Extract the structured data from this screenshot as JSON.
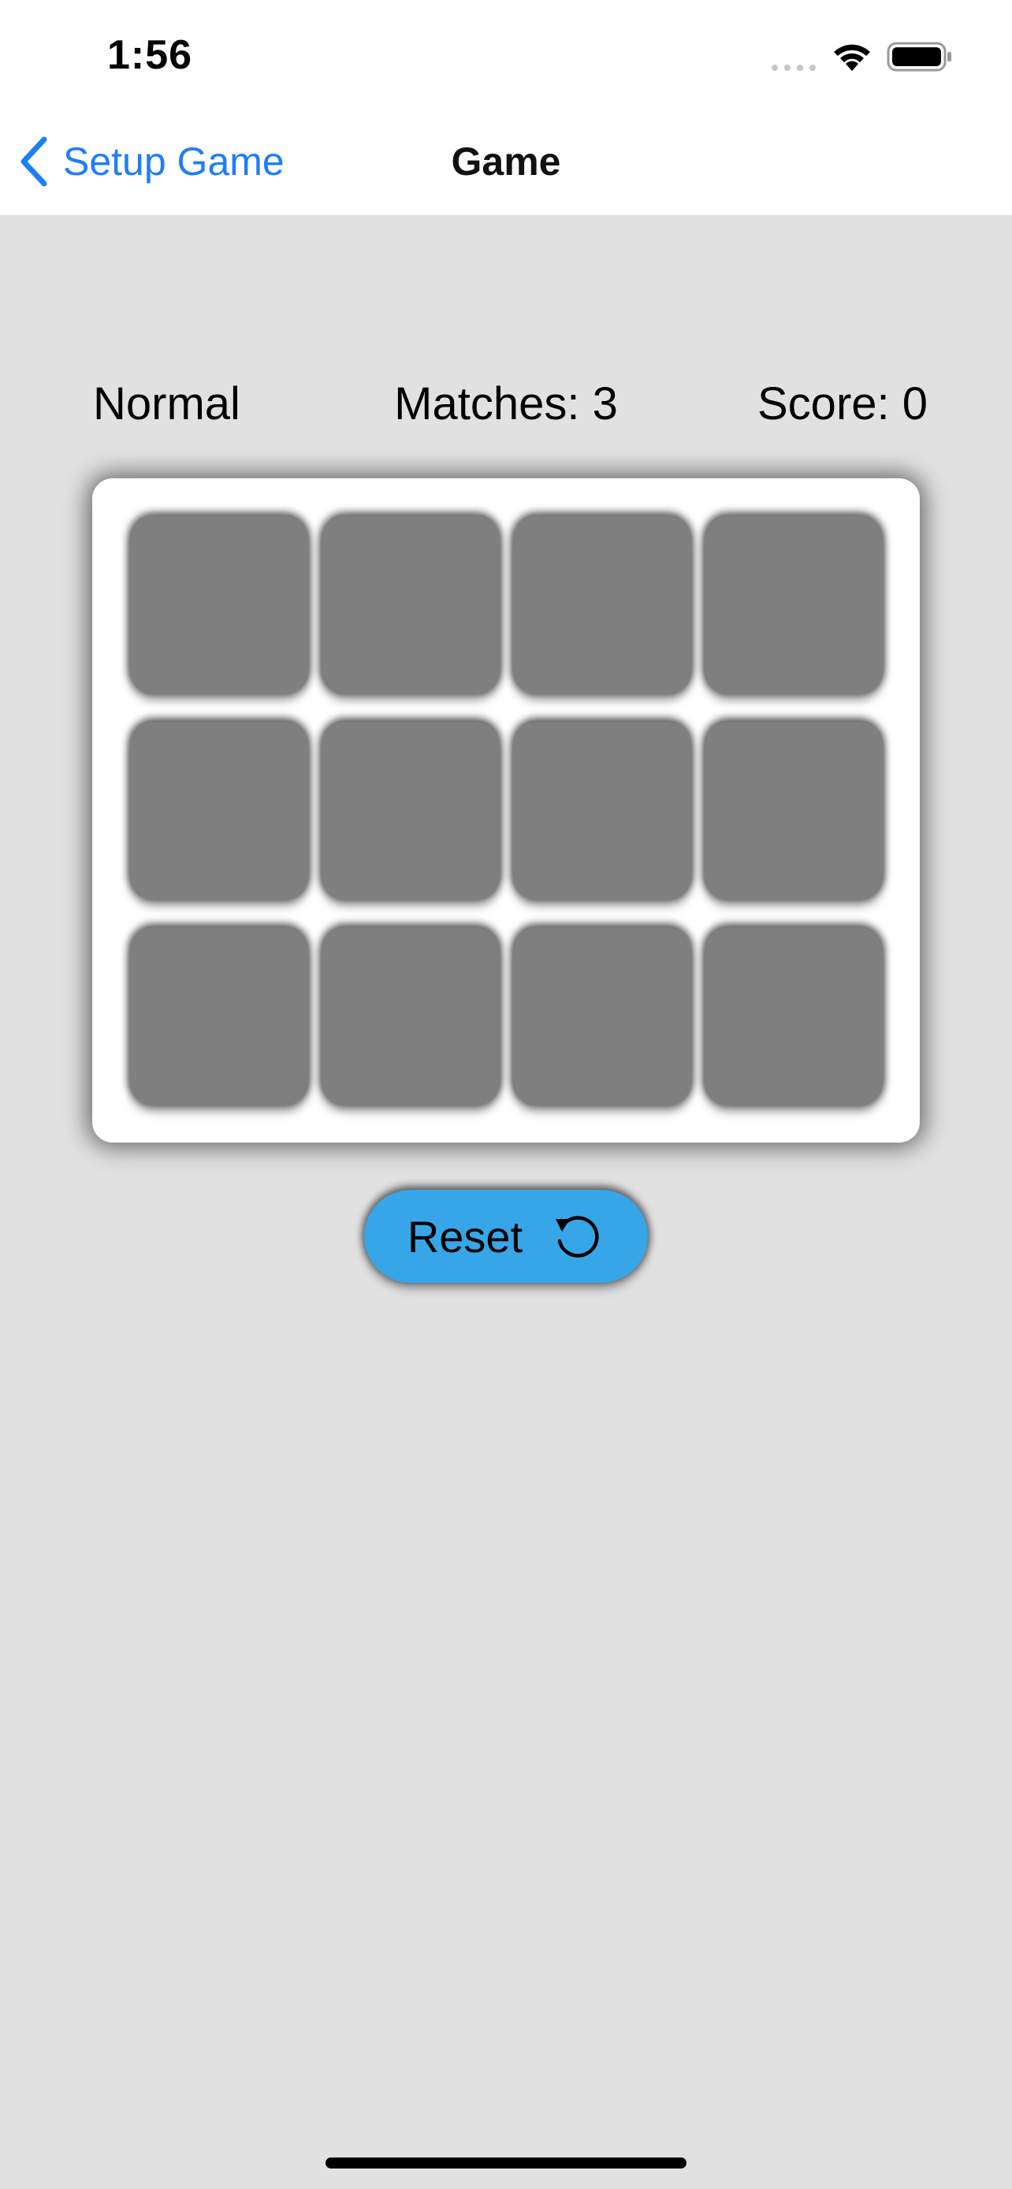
{
  "status_bar": {
    "time": "1:56",
    "icons": [
      "signal-icon",
      "wifi-icon",
      "battery-icon"
    ]
  },
  "nav": {
    "back_label": "Setup Game",
    "title": "Game"
  },
  "game_info": {
    "difficulty": "Normal",
    "matches": "Matches: 3",
    "score": "Score: 0"
  },
  "board": {
    "rows": 3,
    "columns": 4,
    "cards": [
      {
        "state": "face-down"
      },
      {
        "state": "face-down"
      },
      {
        "state": "face-down"
      },
      {
        "state": "face-down"
      },
      {
        "state": "face-down"
      },
      {
        "state": "face-down"
      },
      {
        "state": "face-down"
      },
      {
        "state": "face-down"
      },
      {
        "state": "face-down"
      },
      {
        "state": "face-down"
      },
      {
        "state": "face-down"
      },
      {
        "state": "face-down"
      }
    ]
  },
  "reset_button": {
    "label": "Reset",
    "icon": "reset-icon"
  },
  "colors": {
    "accent": "#1e7ef7",
    "background": "#e1e1e1",
    "card_back": "#7f7f7f",
    "reset_button": "#36a6e8"
  }
}
